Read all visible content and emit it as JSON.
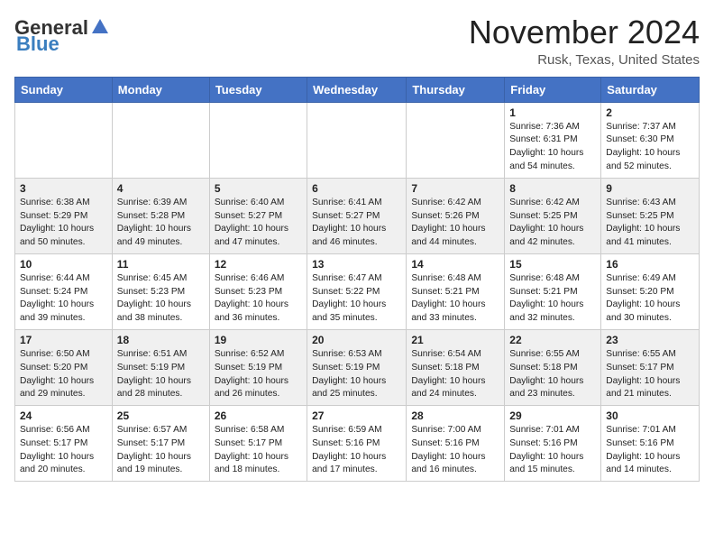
{
  "header": {
    "logo_general": "General",
    "logo_blue": "Blue",
    "month": "November 2024",
    "location": "Rusk, Texas, United States"
  },
  "weekdays": [
    "Sunday",
    "Monday",
    "Tuesday",
    "Wednesday",
    "Thursday",
    "Friday",
    "Saturday"
  ],
  "weeks": [
    [
      {
        "day": "",
        "info": ""
      },
      {
        "day": "",
        "info": ""
      },
      {
        "day": "",
        "info": ""
      },
      {
        "day": "",
        "info": ""
      },
      {
        "day": "",
        "info": ""
      },
      {
        "day": "1",
        "info": "Sunrise: 7:36 AM\nSunset: 6:31 PM\nDaylight: 10 hours and 54 minutes."
      },
      {
        "day": "2",
        "info": "Sunrise: 7:37 AM\nSunset: 6:30 PM\nDaylight: 10 hours and 52 minutes."
      }
    ],
    [
      {
        "day": "3",
        "info": "Sunrise: 6:38 AM\nSunset: 5:29 PM\nDaylight: 10 hours and 50 minutes."
      },
      {
        "day": "4",
        "info": "Sunrise: 6:39 AM\nSunset: 5:28 PM\nDaylight: 10 hours and 49 minutes."
      },
      {
        "day": "5",
        "info": "Sunrise: 6:40 AM\nSunset: 5:27 PM\nDaylight: 10 hours and 47 minutes."
      },
      {
        "day": "6",
        "info": "Sunrise: 6:41 AM\nSunset: 5:27 PM\nDaylight: 10 hours and 46 minutes."
      },
      {
        "day": "7",
        "info": "Sunrise: 6:42 AM\nSunset: 5:26 PM\nDaylight: 10 hours and 44 minutes."
      },
      {
        "day": "8",
        "info": "Sunrise: 6:42 AM\nSunset: 5:25 PM\nDaylight: 10 hours and 42 minutes."
      },
      {
        "day": "9",
        "info": "Sunrise: 6:43 AM\nSunset: 5:25 PM\nDaylight: 10 hours and 41 minutes."
      }
    ],
    [
      {
        "day": "10",
        "info": "Sunrise: 6:44 AM\nSunset: 5:24 PM\nDaylight: 10 hours and 39 minutes."
      },
      {
        "day": "11",
        "info": "Sunrise: 6:45 AM\nSunset: 5:23 PM\nDaylight: 10 hours and 38 minutes."
      },
      {
        "day": "12",
        "info": "Sunrise: 6:46 AM\nSunset: 5:23 PM\nDaylight: 10 hours and 36 minutes."
      },
      {
        "day": "13",
        "info": "Sunrise: 6:47 AM\nSunset: 5:22 PM\nDaylight: 10 hours and 35 minutes."
      },
      {
        "day": "14",
        "info": "Sunrise: 6:48 AM\nSunset: 5:21 PM\nDaylight: 10 hours and 33 minutes."
      },
      {
        "day": "15",
        "info": "Sunrise: 6:48 AM\nSunset: 5:21 PM\nDaylight: 10 hours and 32 minutes."
      },
      {
        "day": "16",
        "info": "Sunrise: 6:49 AM\nSunset: 5:20 PM\nDaylight: 10 hours and 30 minutes."
      }
    ],
    [
      {
        "day": "17",
        "info": "Sunrise: 6:50 AM\nSunset: 5:20 PM\nDaylight: 10 hours and 29 minutes."
      },
      {
        "day": "18",
        "info": "Sunrise: 6:51 AM\nSunset: 5:19 PM\nDaylight: 10 hours and 28 minutes."
      },
      {
        "day": "19",
        "info": "Sunrise: 6:52 AM\nSunset: 5:19 PM\nDaylight: 10 hours and 26 minutes."
      },
      {
        "day": "20",
        "info": "Sunrise: 6:53 AM\nSunset: 5:19 PM\nDaylight: 10 hours and 25 minutes."
      },
      {
        "day": "21",
        "info": "Sunrise: 6:54 AM\nSunset: 5:18 PM\nDaylight: 10 hours and 24 minutes."
      },
      {
        "day": "22",
        "info": "Sunrise: 6:55 AM\nSunset: 5:18 PM\nDaylight: 10 hours and 23 minutes."
      },
      {
        "day": "23",
        "info": "Sunrise: 6:55 AM\nSunset: 5:17 PM\nDaylight: 10 hours and 21 minutes."
      }
    ],
    [
      {
        "day": "24",
        "info": "Sunrise: 6:56 AM\nSunset: 5:17 PM\nDaylight: 10 hours and 20 minutes."
      },
      {
        "day": "25",
        "info": "Sunrise: 6:57 AM\nSunset: 5:17 PM\nDaylight: 10 hours and 19 minutes."
      },
      {
        "day": "26",
        "info": "Sunrise: 6:58 AM\nSunset: 5:17 PM\nDaylight: 10 hours and 18 minutes."
      },
      {
        "day": "27",
        "info": "Sunrise: 6:59 AM\nSunset: 5:16 PM\nDaylight: 10 hours and 17 minutes."
      },
      {
        "day": "28",
        "info": "Sunrise: 7:00 AM\nSunset: 5:16 PM\nDaylight: 10 hours and 16 minutes."
      },
      {
        "day": "29",
        "info": "Sunrise: 7:01 AM\nSunset: 5:16 PM\nDaylight: 10 hours and 15 minutes."
      },
      {
        "day": "30",
        "info": "Sunrise: 7:01 AM\nSunset: 5:16 PM\nDaylight: 10 hours and 14 minutes."
      }
    ]
  ]
}
